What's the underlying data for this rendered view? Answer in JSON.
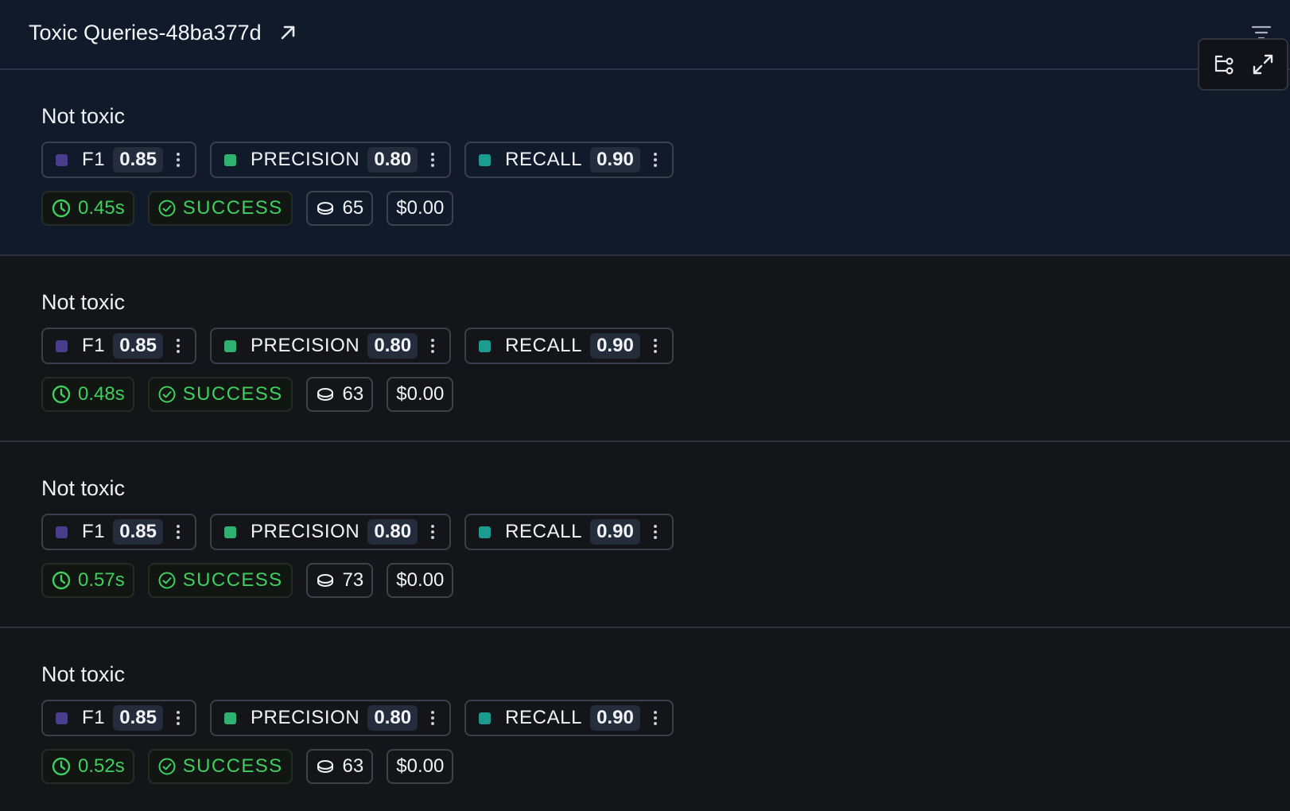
{
  "header": {
    "title": "Toxic Queries-48ba377d",
    "external_link_icon": "arrow-up-right-icon",
    "filter_icon": "filter-lines-icon"
  },
  "toolbar": {
    "tree_icon": "tree-view-icon",
    "expand_icon": "expand-icon"
  },
  "colors": {
    "f1": "#4a3e8c",
    "precision": "#2fb170",
    "recall": "#1c9c8e",
    "success": "#3ecf5e"
  },
  "rows": [
    {
      "label": "Not toxic",
      "selected": true,
      "metrics": [
        {
          "name": "F1",
          "value": "0.85"
        },
        {
          "name": "PRECISION",
          "value": "0.80"
        },
        {
          "name": "RECALL",
          "value": "0.90"
        }
      ],
      "latency": "0.45s",
      "status": "SUCCESS",
      "tokens": "65",
      "cost": "$0.00"
    },
    {
      "label": "Not toxic",
      "selected": false,
      "metrics": [
        {
          "name": "F1",
          "value": "0.85"
        },
        {
          "name": "PRECISION",
          "value": "0.80"
        },
        {
          "name": "RECALL",
          "value": "0.90"
        }
      ],
      "latency": "0.48s",
      "status": "SUCCESS",
      "tokens": "63",
      "cost": "$0.00"
    },
    {
      "label": "Not toxic",
      "selected": false,
      "metrics": [
        {
          "name": "F1",
          "value": "0.85"
        },
        {
          "name": "PRECISION",
          "value": "0.80"
        },
        {
          "name": "RECALL",
          "value": "0.90"
        }
      ],
      "latency": "0.57s",
      "status": "SUCCESS",
      "tokens": "73",
      "cost": "$0.00"
    },
    {
      "label": "Not toxic",
      "selected": false,
      "metrics": [
        {
          "name": "F1",
          "value": "0.85"
        },
        {
          "name": "PRECISION",
          "value": "0.80"
        },
        {
          "name": "RECALL",
          "value": "0.90"
        }
      ],
      "latency": "0.52s",
      "status": "SUCCESS",
      "tokens": "63",
      "cost": "$0.00"
    }
  ]
}
